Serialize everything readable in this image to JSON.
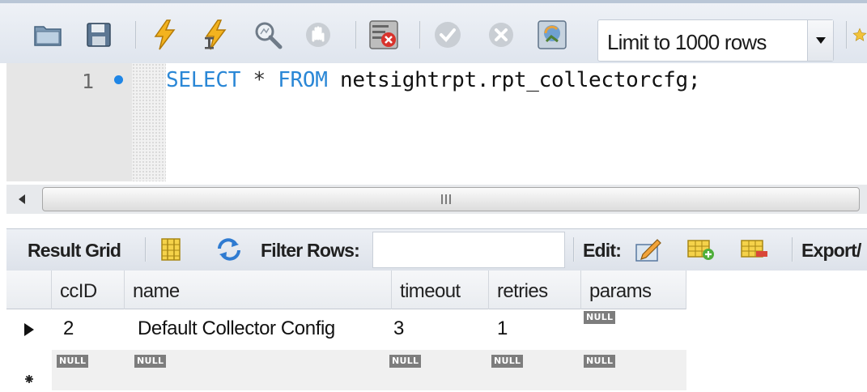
{
  "toolbar": {
    "buttons": [
      {
        "name": "open-folder",
        "icon": "folder-icon"
      },
      {
        "name": "save-script",
        "icon": "floppy-disk-icon"
      },
      {
        "name": "execute-all",
        "icon": "lightning-icon"
      },
      {
        "name": "execute-current",
        "icon": "lightning-cursor-icon"
      },
      {
        "name": "explain",
        "icon": "magnifier-icon"
      },
      {
        "name": "stop",
        "icon": "hand-stop-icon"
      },
      {
        "name": "toggle-continue-on-error",
        "icon": "error-toggle-icon"
      },
      {
        "name": "commit",
        "icon": "check-icon"
      },
      {
        "name": "rollback",
        "icon": "cancel-icon"
      },
      {
        "name": "autocommit",
        "icon": "autocommit-icon"
      }
    ],
    "limit_select_value": "Limit to 1000 rows"
  },
  "editor": {
    "line_number": "1",
    "code": {
      "kw_select": "SELECT",
      "star": "*",
      "kw_from": "FROM",
      "table": "netsightrpt.rpt_collectorcfg;"
    }
  },
  "result_toolbar": {
    "result_grid_label": "Result Grid",
    "filter_rows_label": "Filter Rows:",
    "filter_value": "",
    "edit_label": "Edit:",
    "export_label": "Export/"
  },
  "grid": {
    "columns": [
      "ccID",
      "name",
      "timeout",
      "retries",
      "params"
    ],
    "rows": [
      {
        "ccID": "2",
        "name": "Default Collector Config",
        "timeout": "3",
        "retries": "1",
        "params": "NULL"
      },
      {
        "ccID": "NULL",
        "name": "NULL",
        "timeout": "NULL",
        "retries": "NULL",
        "params": "NULL"
      }
    ]
  },
  "colors": {
    "keyword": "#2a87d6",
    "breakpoint": "#1f86e6",
    "null_badge": "#7d7d7d"
  }
}
